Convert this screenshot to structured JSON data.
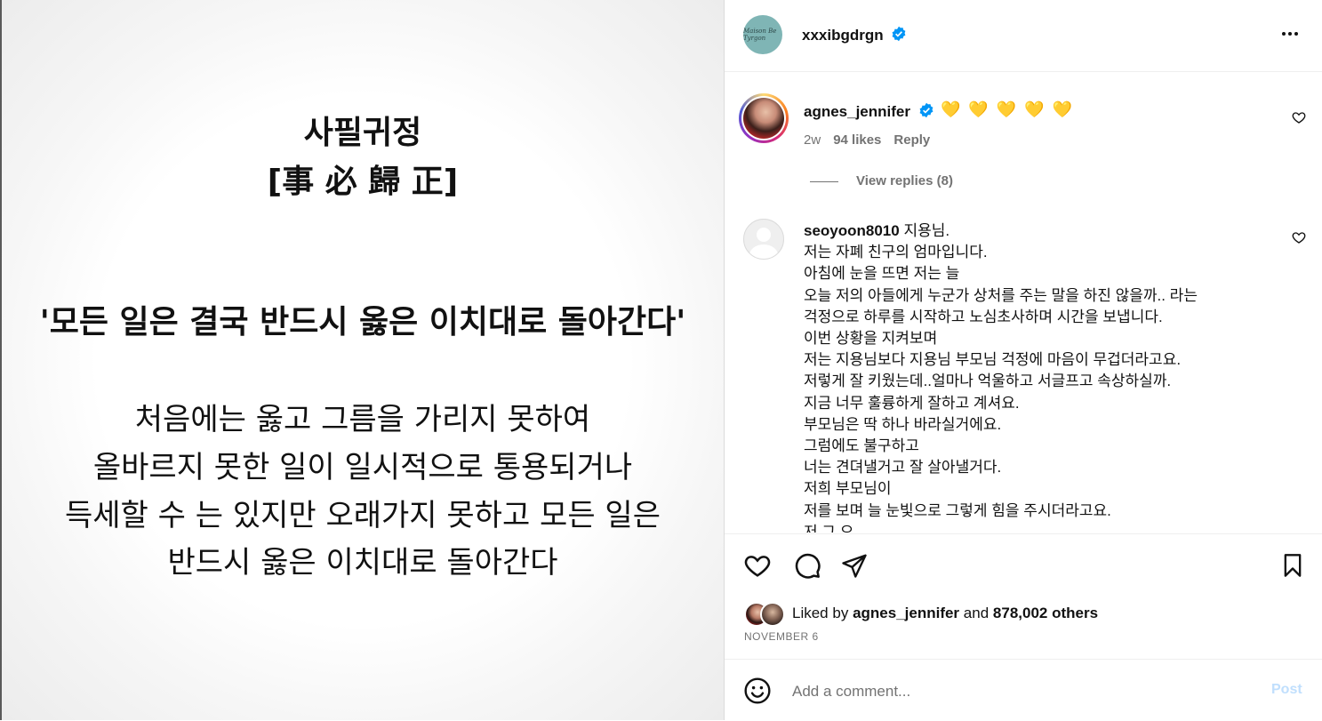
{
  "image_text": {
    "title_line1": "사필귀정",
    "title_line2": "[事 必 歸 正]",
    "quote": "'모든 일은 결국 반드시 옳은 이치대로 돌아간다'",
    "body": [
      "처음에는 옳고 그름을 가리지 못하여",
      "올바르지 못한 일이 일시적으로 통용되거나",
      "득세할 수 는 있지만 오래가지 못하고 모든 일은",
      "반드시 옳은 이치대로 돌아간다"
    ]
  },
  "header": {
    "username": "xxxibgdrgn",
    "avatar_text": "Maison Be Tyrgon",
    "verified_icon": "verified-badge-icon",
    "more_icon": "more-horizontal-icon"
  },
  "comments": {
    "first": {
      "username": "agnes_jennifer",
      "text": "💛 💛 💛 💛 💛",
      "time": "2w",
      "likes": "94 likes",
      "reply_label": "Reply",
      "view_replies": "View replies (8)"
    },
    "second": {
      "username": "seoyoon8010",
      "lines": [
        "지용님.",
        "저는 자폐 친구의 엄마입니다.",
        "아침에 눈을 뜨면 저는 늘",
        "오늘 저의 아들에게 누군가 상처를 주는 말을 하진 않을까.. 라는",
        "걱정으로 하루를 시작하고 노심초사하며 시간을 보냅니다.",
        "이번 상황을 지켜보며",
        "저는 지용님보다 지용님 부모님 걱정에 마음이 무겁더라고요.",
        "저렇게 잘 키웠는데..얼마나 억울하고 서글프고 속상하실까.",
        "지금 너무 훌륭하게 잘하고 계셔요.",
        "부모님은 딱 하나 바라실거에요.",
        "그럼에도 불구하고",
        "너는 견뎌낼거고 잘 살아낼거다.",
        "저희 부모님이",
        "저를 보며 늘 눈빛으로 그렇게 힘을 주시더라고요.",
        "저 그 오"
      ]
    }
  },
  "actions": {
    "like_icon": "heart-icon",
    "comment_icon": "comment-icon",
    "share_icon": "share-icon",
    "save_icon": "bookmark-icon"
  },
  "liked_by": {
    "prefix": "Liked by",
    "user": "agnes_jennifer",
    "connector": "and",
    "others": "878,002 others"
  },
  "date": "NOVEMBER 6",
  "add_comment": {
    "placeholder": "Add a comment...",
    "post_label": "Post",
    "emoji_icon": "emoji-icon"
  },
  "colors": {
    "verified": "#0095f6",
    "post_disabled": "#c0dffd",
    "secondary_text": "#737373"
  }
}
